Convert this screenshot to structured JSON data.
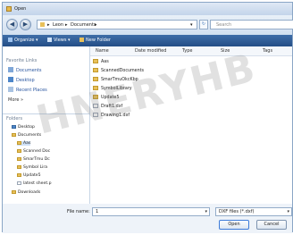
{
  "window": {
    "title": "Open"
  },
  "address": {
    "path": [
      "Leon",
      "Documents"
    ],
    "separator": "▸",
    "search_placeholder": "Search"
  },
  "toolbar": {
    "organize": "Organize ▾",
    "views": "Views ▾",
    "new_folder": "New Folder"
  },
  "sidebar": {
    "favorite_links_label": "Favorite Links",
    "favorites": [
      {
        "label": "Documents",
        "icon": "documents-icon"
      },
      {
        "label": "Desktop",
        "icon": "desktop-icon"
      },
      {
        "label": "Recent Places",
        "icon": "recent-places-icon"
      },
      {
        "label": "More »",
        "icon": ""
      }
    ],
    "folders_label": "Folders",
    "tree": [
      {
        "label": "Desktop",
        "level": 1
      },
      {
        "label": "Documents",
        "level": 1
      },
      {
        "label": "Aas",
        "level": 2
      },
      {
        "label": "Scanned Doc",
        "level": 2
      },
      {
        "label": "SmarTmu Dc",
        "level": 2
      },
      {
        "label": "Symbol Lira",
        "level": 2
      },
      {
        "label": "Update5",
        "level": 2
      },
      {
        "label": "latest sheet.p",
        "level": 2
      },
      {
        "label": "Downloads",
        "level": 1
      }
    ]
  },
  "columns": [
    "Name",
    "Date modified",
    "Type",
    "Size",
    "Tags"
  ],
  "files": [
    {
      "name": "Aas",
      "kind": "folder"
    },
    {
      "name": "ScannedDocuments",
      "kind": "folder"
    },
    {
      "name": "SmarTmuOkcKbp",
      "kind": "folder"
    },
    {
      "name": "SymbolLibrary",
      "kind": "folder"
    },
    {
      "name": "Update5",
      "kind": "folder"
    },
    {
      "name": "Draft1.dxf",
      "kind": "file"
    },
    {
      "name": "Drawing1.dxf",
      "kind": "file"
    }
  ],
  "bottom": {
    "filename_label": "File name:",
    "filename_value": "1",
    "filetype": "DXF files (*.dxf)",
    "open_label": "Open",
    "cancel_label": "Cancel"
  },
  "watermark": "HNERYHB"
}
